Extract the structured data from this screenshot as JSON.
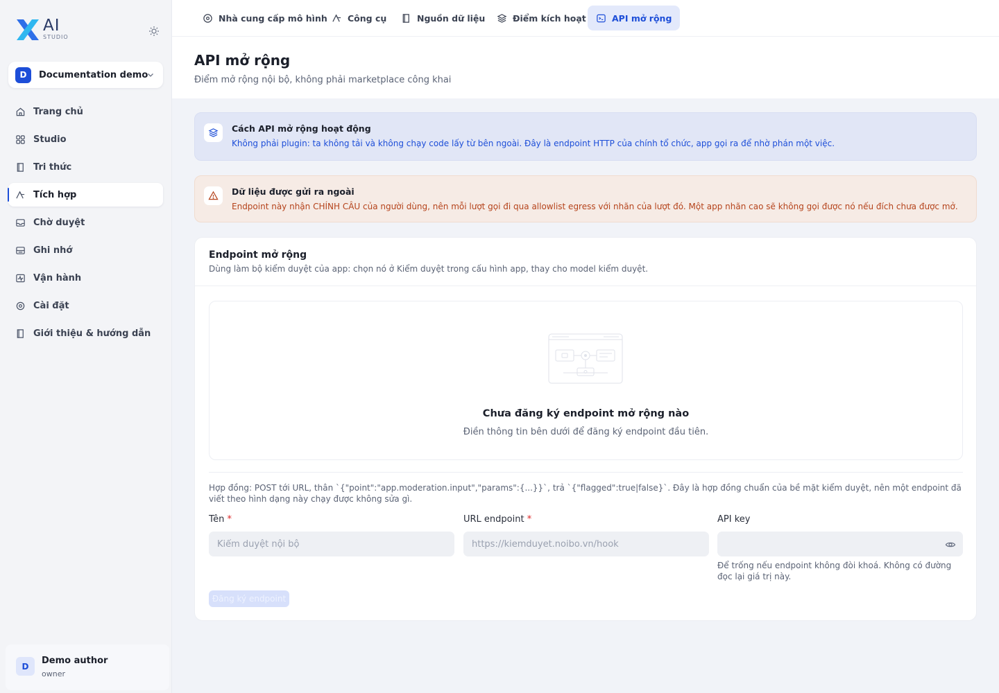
{
  "brand": {
    "logo_mark": "X",
    "logo_text": "AI",
    "logo_sub": "STUDIO"
  },
  "workspace": {
    "initial": "D",
    "name": "Documentation demo"
  },
  "sidebar": {
    "items": [
      {
        "label": "Trang chủ",
        "icon": "home-icon"
      },
      {
        "label": "Studio",
        "icon": "grid-icon"
      },
      {
        "label": "Tri thức",
        "icon": "book-icon"
      },
      {
        "label": "Tích hợp",
        "icon": "integration-icon",
        "active": true
      },
      {
        "label": "Chờ duyệt",
        "icon": "inbox-icon"
      },
      {
        "label": "Ghi nhớ",
        "icon": "memory-icon"
      },
      {
        "label": "Vận hành",
        "icon": "activity-icon"
      },
      {
        "label": "Cài đặt",
        "icon": "gear-icon"
      },
      {
        "label": "Giới thiệu & hướng dẫn",
        "icon": "guide-icon"
      }
    ]
  },
  "user": {
    "initial": "D",
    "name": "Demo author",
    "role": "owner"
  },
  "tabs": [
    {
      "label": "Nhà cung cấp mô hình",
      "icon": "model-provider-icon"
    },
    {
      "label": "Công cụ",
      "icon": "tools-icon"
    },
    {
      "label": "Nguồn dữ liệu",
      "icon": "datasource-icon"
    },
    {
      "label": "Điểm kích hoạt",
      "icon": "trigger-icon"
    },
    {
      "label": "API mở rộng",
      "icon": "api-icon",
      "active": true
    }
  ],
  "page": {
    "title": "API mở rộng",
    "subtitle": "Điểm mở rộng nội bộ, không phải marketplace công khai"
  },
  "info_callout": {
    "title": "Cách API mở rộng hoạt động",
    "text": "Không phải plugin: ta không tải và không chạy code lấy từ bên ngoài. Đây là endpoint HTTP của chính tổ chức, app gọi ra để nhờ phán một việc."
  },
  "warning_callout": {
    "title": "Dữ liệu được gửi ra ngoài",
    "text": "Endpoint này nhận CHÍNH CÂU của người dùng, nên mỗi lượt gọi đi qua allowlist egress với nhãn của lượt đó. Một app nhãn cao sẽ không gọi được nó nếu đích chưa được mở."
  },
  "endpoints_card": {
    "title": "Endpoint mở rộng",
    "description": "Dùng làm bộ kiểm duyệt của app: chọn nó ở Kiểm duyệt trong cấu hình app, thay cho model kiểm duyệt.",
    "empty_title": "Chưa đăng ký endpoint mở rộng nào",
    "empty_desc": "Điền thông tin bên dưới để đăng ký endpoint đầu tiên.",
    "contract": "Hợp đồng: POST tới URL, thân `{\"point\":\"app.moderation.input\",\"params\":{...}}`, trả `{\"flagged\":true|false}`. Đây là hợp đồng chuẩn của bề mặt kiểm duyệt, nên một endpoint đã viết theo hình dạng này chạy được không sửa gì."
  },
  "form": {
    "name_label": "Tên",
    "name_placeholder": "Kiểm duyệt nội bộ",
    "url_label": "URL endpoint",
    "url_placeholder": "https://kiemduyet.noibo.vn/hook",
    "key_label": "API key",
    "key_value": "",
    "key_help": "Để trống nếu endpoint không đòi khoá. Không có đường đọc lại giá trị này.",
    "required_mark": "*",
    "submit_label": "Đăng ký endpoint"
  },
  "colors": {
    "accent": "#1d4ed8",
    "warning": "#b5431b",
    "required": "#dc2626"
  }
}
